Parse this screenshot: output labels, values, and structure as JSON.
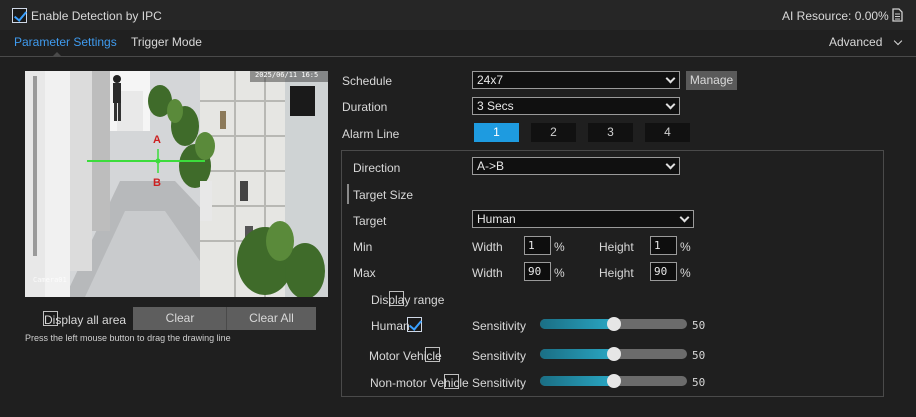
{
  "header": {
    "enable_label": "Enable Detection by IPC",
    "enable_checked": true,
    "ai_resource_label": "AI Resource: 0.00%",
    "ai_resource_icon": "document-icon"
  },
  "tabs": [
    {
      "label": "Parameter Settings",
      "active": true
    },
    {
      "label": "Trigger Mode",
      "active": false
    }
  ],
  "advanced_label": "Advanced",
  "video": {
    "timestamp": "2025/06/11 16:5",
    "camera_name": "Camera01",
    "line_label_a": "A",
    "line_label_b": "B"
  },
  "display_all_area_label": "Display all area",
  "clear_label": "Clear",
  "clear_all_label": "Clear All",
  "hint": "Press the left mouse button to drag the drawing line",
  "schedule": {
    "label": "Schedule",
    "value": "24x7",
    "manage_label": "Manage"
  },
  "duration": {
    "label": "Duration",
    "value": "3 Secs"
  },
  "alarm_line": {
    "label": "Alarm Line",
    "options": [
      "1",
      "2",
      "3",
      "4"
    ],
    "selected": "1"
  },
  "direction": {
    "label": "Direction",
    "value": "A->B"
  },
  "target_size_label": "Target Size",
  "target": {
    "label": "Target",
    "value": "Human"
  },
  "min": {
    "label": "Min",
    "width_label": "Width",
    "width": "1",
    "height_label": "Height",
    "height": "1",
    "unit": "%"
  },
  "max": {
    "label": "Max",
    "width_label": "Width",
    "width": "90",
    "height_label": "Height",
    "height": "90",
    "unit": "%"
  },
  "display_range_label": "Display range",
  "sensitivity_rows": [
    {
      "label": "Human",
      "checked": true,
      "sensitivity_label": "Sensitivity",
      "value": "50",
      "level": 0.5
    },
    {
      "label": "Motor Vehicle",
      "checked": false,
      "sensitivity_label": "Sensitivity",
      "value": "50",
      "level": 0.5
    },
    {
      "label": "Non-motor Vehicle",
      "checked": false,
      "sensitivity_label": "Sensitivity",
      "value": "50",
      "level": 0.5
    }
  ],
  "colors": {
    "accent": "#3f9bef",
    "active_button": "#1e9be0",
    "alarm_line": "#3cdc3c",
    "label_red": "#cc2020"
  }
}
